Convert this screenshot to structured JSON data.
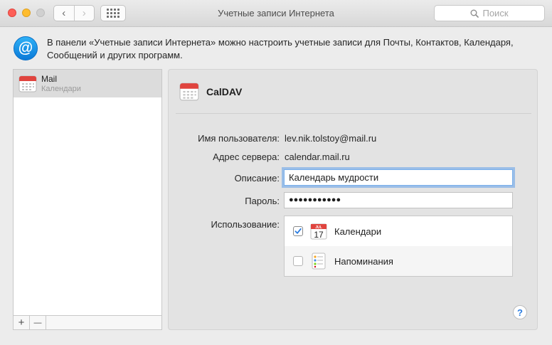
{
  "window": {
    "title": "Учетные записи Интернета",
    "search_placeholder": "Поиск"
  },
  "toolbar": {
    "back_glyph": "‹",
    "forward_glyph": "›"
  },
  "info": {
    "text": "В панели «Учетные записи Интернета» можно настроить учетные записи для Почты, Контактов, Календаря, Сообщений и других программ."
  },
  "accounts": {
    "items": [
      {
        "title": "Mail",
        "subtitle": "Календари",
        "icon": "calendar-icon"
      }
    ],
    "add_label": "+",
    "remove_label": "—"
  },
  "detail": {
    "title": "CalDAV",
    "username_label": "Имя пользователя:",
    "username_value": "lev.nik.tolstoy@mail.ru",
    "server_label": "Адрес сервера:",
    "server_value": "calendar.mail.ru",
    "description_label": "Описание:",
    "description_value": "Календарь мудрости",
    "password_label": "Пароль:",
    "password_value": "●●●●●●●●●●●",
    "usage_label": "Использование:",
    "usage": [
      {
        "label": "Календари",
        "checked": true,
        "icon": "calendar-app-icon",
        "icon_month": "JUL",
        "icon_day": "17"
      },
      {
        "label": "Напоминания",
        "checked": false,
        "icon": "reminders-app-icon"
      }
    ],
    "help_label": "?"
  },
  "colors": {
    "accent": "#2a7ce0",
    "calendar_red": "#e0443e",
    "checkbox_check": "#2a7ce0"
  }
}
